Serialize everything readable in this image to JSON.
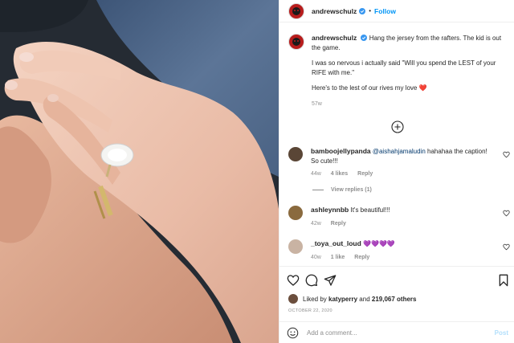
{
  "post": {
    "username": "andrewschulz",
    "separator": "•",
    "follow_label": "Follow"
  },
  "caption": {
    "username": "andrewschulz",
    "line1": "Hang the jersey from the rafters. The kid is out the game.",
    "line2": "I was so nervous i actually said \"Will you spend the LEST of your RIFE with me.\"",
    "line3": "Here's to the lest of our rives my love",
    "heart": "❤️",
    "timestamp": "57w"
  },
  "comments": [
    {
      "username": "bamboojellypanda",
      "mention": "@aishahjamaludin",
      "text": "hahahaa the caption! So cute!!!",
      "time": "44w",
      "likes": "4 likes",
      "reply": "Reply",
      "avatar_color": "#5a4636"
    },
    {
      "username": "ashleynnbb",
      "text": "It's beautiful!!!",
      "time": "42w",
      "reply": "Reply",
      "avatar_color": "#8a6a3e"
    },
    {
      "username": "_toya_out_loud",
      "text": "💜💜💜💜",
      "time": "40w",
      "likes": "1 like",
      "reply": "Reply",
      "avatar_color": "#c9b3a3"
    }
  ],
  "view_replies": "View replies (1)",
  "likes": {
    "prefix": "Liked by",
    "user": "katyperry",
    "and": "and",
    "count": "219,067 others"
  },
  "date": "OCTOBER 22, 2020",
  "add_comment": {
    "placeholder": "Add a comment...",
    "post_label": "Post"
  },
  "colors": {
    "accent": "#0095f6",
    "verified": "#3897f0",
    "brand_avatar": "#b71c1c"
  }
}
